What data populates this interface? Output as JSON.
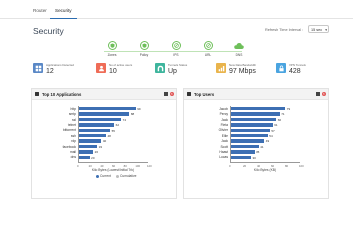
{
  "tabs": [
    {
      "label": "Router",
      "active": false
    },
    {
      "label": "Security",
      "active": true
    }
  ],
  "page_title": "Security",
  "refresh": {
    "label": "Refresh Time Interval :",
    "value": "15 sec"
  },
  "status_items": [
    {
      "label": "Zones",
      "icon": "shield-check-icon"
    },
    {
      "label": "Policy",
      "icon": "shield-check-icon"
    },
    {
      "label": "IPS",
      "icon": "block-icon"
    },
    {
      "label": "URL",
      "icon": "block-icon"
    },
    {
      "label": "DNS",
      "icon": "cloud-icon"
    }
  ],
  "status_color": "#6ebf5a",
  "tiles": [
    {
      "label": "Applications Detected",
      "value": "12",
      "color": "#5a88c6"
    },
    {
      "label": "No of active users",
      "value": "10",
      "color": "#ef6c57"
    },
    {
      "label": "Tunnels Status",
      "value": "Up",
      "color": "#3eb59d"
    },
    {
      "label": "New Data Bandwidth",
      "value": "97 Mbps",
      "color": "#e9b44c"
    },
    {
      "label": "VPN Tunnels",
      "value": "428",
      "color": "#4aa4e0"
    }
  ],
  "panels": {
    "apps": {
      "title": "Top 10 Applications"
    },
    "users": {
      "title": "Top Users"
    }
  },
  "chart_data": [
    {
      "type": "bar",
      "title": "Top 10 Applications",
      "orientation": "horizontal",
      "categories": [
        "http",
        "smtp",
        "ssl",
        "telnet",
        "bittorrent",
        "ssh",
        "rdp",
        "facebook",
        "mail",
        "dns"
      ],
      "values": [
        99,
        88,
        74,
        62,
        55,
        48,
        40,
        33,
        26,
        20
      ],
      "xlabel": "Kilo Bytes (Lowest/Initial Trk)",
      "xlim": [
        0,
        120
      ],
      "x_ticks": [
        "0",
        "20",
        "40",
        "60",
        "80",
        "100",
        "120"
      ],
      "legend": [
        "Current",
        "Cumulative"
      ],
      "legend_colors": [
        "#3d6fb3",
        "#bdbdbd"
      ],
      "bar_color": "#3d6fb3"
    },
    {
      "type": "bar",
      "title": "Top Users",
      "orientation": "horizontal",
      "categories": [
        "Jacob",
        "Percy",
        "Jack",
        "Fleta",
        "Olivier",
        "Ellie",
        "Jack",
        "Scott",
        "Haast",
        "Lucas"
      ],
      "values": [
        79,
        71,
        66,
        61,
        57,
        54,
        49,
        41,
        35,
        30
      ],
      "xlabel": "Kilo Bytes (KB)",
      "xlim": [
        0,
        100
      ],
      "x_ticks": [
        "0",
        "20",
        "40",
        "60",
        "80",
        "100"
      ],
      "bar_color": "#3d6fb3"
    }
  ]
}
